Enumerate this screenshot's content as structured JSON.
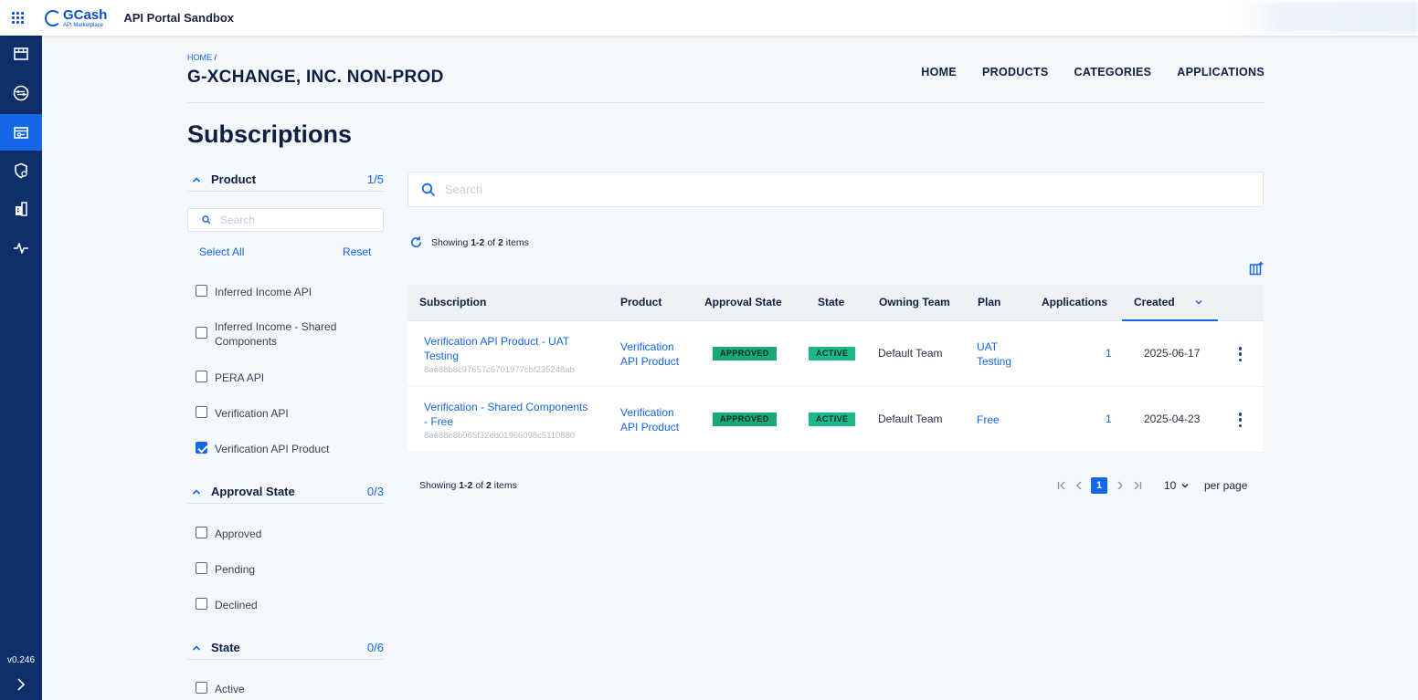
{
  "header": {
    "brand_name": "GCash",
    "brand_sub": "API Marketplace",
    "portal_title": "API Portal Sandbox"
  },
  "sidebar": {
    "items": [
      {
        "icon": "store-icon"
      },
      {
        "icon": "api-flow-icon"
      },
      {
        "icon": "subscriptions-key-icon",
        "active": true
      },
      {
        "icon": "shield-settings-icon"
      },
      {
        "icon": "organization-building-icon"
      },
      {
        "icon": "activity-pulse-icon"
      }
    ],
    "version": "v0.246"
  },
  "breadcrumb": {
    "home": "HOME",
    "separator": "/"
  },
  "org_title": "G-XCHANGE, INC. NON-PROD",
  "nav": {
    "home": "HOME",
    "products": "PRODUCTS",
    "categories": "CATEGORIES",
    "applications": "APPLICATIONS"
  },
  "page_title": "Subscriptions",
  "filters": {
    "product": {
      "label": "Product",
      "count": "1/5",
      "search_placeholder": "Search",
      "select_all": "Select All",
      "reset": "Reset",
      "options": [
        {
          "label": "Inferred Income API",
          "checked": false
        },
        {
          "label": "Inferred Income - Shared Components",
          "checked": false
        },
        {
          "label": "PERA API",
          "checked": false
        },
        {
          "label": "Verification API",
          "checked": false
        },
        {
          "label": "Verification API Product",
          "checked": true
        }
      ]
    },
    "approval_state": {
      "label": "Approval State",
      "count": "0/3",
      "options": [
        {
          "label": "Approved",
          "checked": false
        },
        {
          "label": "Pending",
          "checked": false
        },
        {
          "label": "Declined",
          "checked": false
        }
      ]
    },
    "state": {
      "label": "State",
      "count": "0/6",
      "options": [
        {
          "label": "Active",
          "checked": false
        }
      ]
    }
  },
  "search": {
    "placeholder": "Search"
  },
  "showing": {
    "prefix": "Showing",
    "range": "1-2",
    "of": "of",
    "total": "2",
    "suffix": "items"
  },
  "table": {
    "columns": {
      "subscription": "Subscription",
      "product": "Product",
      "approval_state": "Approval State",
      "state": "State",
      "owning_team": "Owning Team",
      "plan": "Plan",
      "applications": "Applications",
      "created": "Created"
    },
    "rows": [
      {
        "name": "Verification API Product - UAT Testing",
        "id": "8ae88b8c97657c6701977cbf235248ab",
        "product": "Verification API Product",
        "approval_state": "APPROVED",
        "state": "ACTIVE",
        "owning_team": "Default Team",
        "plan": "UAT Testing",
        "applications": "1",
        "created": "2025-06-17"
      },
      {
        "name": "Verification - Shared Components - Free",
        "id": "8ae88e8b965f32ed01966098c5110880",
        "product": "Verification API Product",
        "approval_state": "APPROVED",
        "state": "ACTIVE",
        "owning_team": "Default Team",
        "plan": "Free",
        "applications": "1",
        "created": "2025-04-23"
      }
    ]
  },
  "pagination": {
    "current_page": "1",
    "per_page": "10",
    "per_page_label": "per page"
  },
  "colors": {
    "primary": "#1467e6",
    "sidebar": "#0e2f6a",
    "approved_badge": "#17a978",
    "active_badge": "#1bb88a"
  }
}
